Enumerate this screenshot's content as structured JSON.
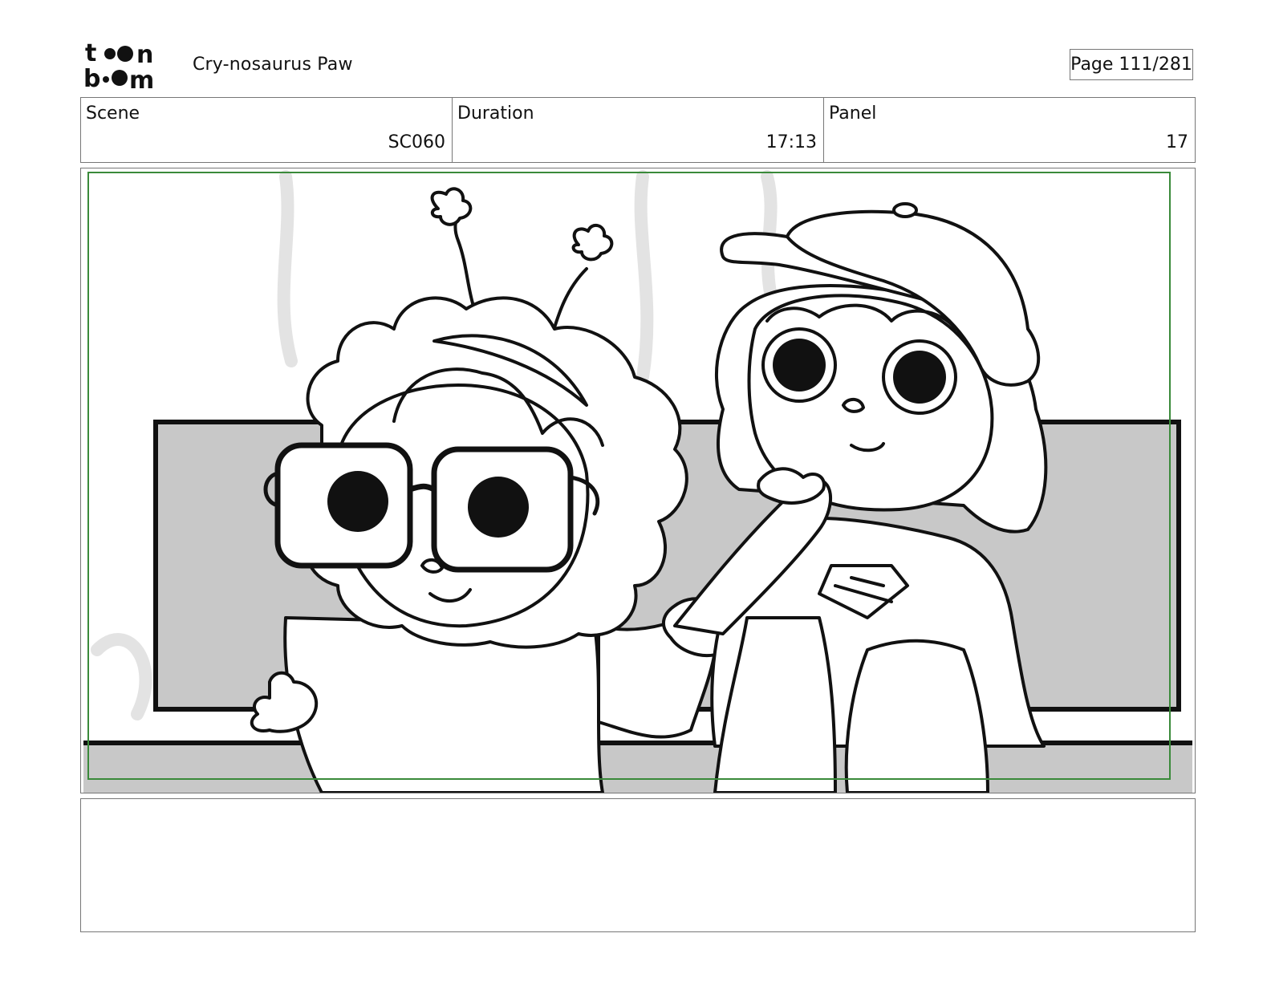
{
  "header": {
    "logo_text": "toon boom",
    "project_title": "Cry-nosaurus Paw",
    "page_label": "Page 111/281"
  },
  "info": {
    "scene_label": "Scene",
    "scene_value": "SC060",
    "duration_label": "Duration",
    "duration_value": "17:13",
    "panel_label": "Panel",
    "panel_value": "17"
  },
  "panel": {
    "safe_area_color": "#3a8a3a",
    "fill_gray": "#c8c8c8"
  },
  "notes": {
    "text": ""
  }
}
